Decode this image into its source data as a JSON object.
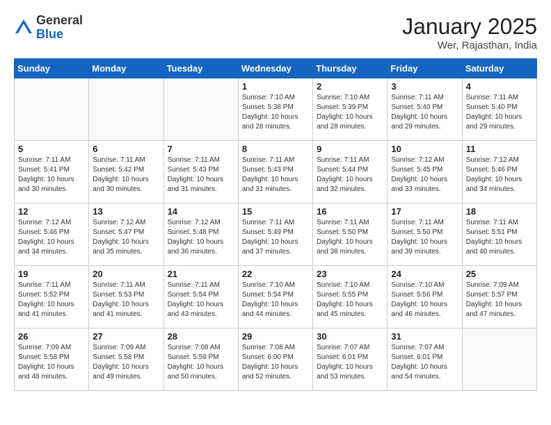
{
  "header": {
    "logo_general": "General",
    "logo_blue": "Blue",
    "title": "January 2025",
    "location": "Wer, Rajasthan, India"
  },
  "days_of_week": [
    "Sunday",
    "Monday",
    "Tuesday",
    "Wednesday",
    "Thursday",
    "Friday",
    "Saturday"
  ],
  "weeks": [
    [
      {
        "day": "",
        "info": ""
      },
      {
        "day": "",
        "info": ""
      },
      {
        "day": "",
        "info": ""
      },
      {
        "day": "1",
        "info": "Sunrise: 7:10 AM\nSunset: 5:38 PM\nDaylight: 10 hours\nand 28 minutes."
      },
      {
        "day": "2",
        "info": "Sunrise: 7:10 AM\nSunset: 5:39 PM\nDaylight: 10 hours\nand 28 minutes."
      },
      {
        "day": "3",
        "info": "Sunrise: 7:11 AM\nSunset: 5:40 PM\nDaylight: 10 hours\nand 29 minutes."
      },
      {
        "day": "4",
        "info": "Sunrise: 7:11 AM\nSunset: 5:40 PM\nDaylight: 10 hours\nand 29 minutes."
      }
    ],
    [
      {
        "day": "5",
        "info": "Sunrise: 7:11 AM\nSunset: 5:41 PM\nDaylight: 10 hours\nand 30 minutes."
      },
      {
        "day": "6",
        "info": "Sunrise: 7:11 AM\nSunset: 5:42 PM\nDaylight: 10 hours\nand 30 minutes."
      },
      {
        "day": "7",
        "info": "Sunrise: 7:11 AM\nSunset: 5:43 PM\nDaylight: 10 hours\nand 31 minutes."
      },
      {
        "day": "8",
        "info": "Sunrise: 7:11 AM\nSunset: 5:43 PM\nDaylight: 10 hours\nand 31 minutes."
      },
      {
        "day": "9",
        "info": "Sunrise: 7:11 AM\nSunset: 5:44 PM\nDaylight: 10 hours\nand 32 minutes."
      },
      {
        "day": "10",
        "info": "Sunrise: 7:12 AM\nSunset: 5:45 PM\nDaylight: 10 hours\nand 33 minutes."
      },
      {
        "day": "11",
        "info": "Sunrise: 7:12 AM\nSunset: 5:46 PM\nDaylight: 10 hours\nand 34 minutes."
      }
    ],
    [
      {
        "day": "12",
        "info": "Sunrise: 7:12 AM\nSunset: 5:46 PM\nDaylight: 10 hours\nand 34 minutes."
      },
      {
        "day": "13",
        "info": "Sunrise: 7:12 AM\nSunset: 5:47 PM\nDaylight: 10 hours\nand 35 minutes."
      },
      {
        "day": "14",
        "info": "Sunrise: 7:12 AM\nSunset: 5:48 PM\nDaylight: 10 hours\nand 36 minutes."
      },
      {
        "day": "15",
        "info": "Sunrise: 7:11 AM\nSunset: 5:49 PM\nDaylight: 10 hours\nand 37 minutes."
      },
      {
        "day": "16",
        "info": "Sunrise: 7:11 AM\nSunset: 5:50 PM\nDaylight: 10 hours\nand 38 minutes."
      },
      {
        "day": "17",
        "info": "Sunrise: 7:11 AM\nSunset: 5:50 PM\nDaylight: 10 hours\nand 39 minutes."
      },
      {
        "day": "18",
        "info": "Sunrise: 7:11 AM\nSunset: 5:51 PM\nDaylight: 10 hours\nand 40 minutes."
      }
    ],
    [
      {
        "day": "19",
        "info": "Sunrise: 7:11 AM\nSunset: 5:52 PM\nDaylight: 10 hours\nand 41 minutes."
      },
      {
        "day": "20",
        "info": "Sunrise: 7:11 AM\nSunset: 5:53 PM\nDaylight: 10 hours\nand 41 minutes."
      },
      {
        "day": "21",
        "info": "Sunrise: 7:11 AM\nSunset: 5:54 PM\nDaylight: 10 hours\nand 43 minutes."
      },
      {
        "day": "22",
        "info": "Sunrise: 7:10 AM\nSunset: 5:54 PM\nDaylight: 10 hours\nand 44 minutes."
      },
      {
        "day": "23",
        "info": "Sunrise: 7:10 AM\nSunset: 5:55 PM\nDaylight: 10 hours\nand 45 minutes."
      },
      {
        "day": "24",
        "info": "Sunrise: 7:10 AM\nSunset: 5:56 PM\nDaylight: 10 hours\nand 46 minutes."
      },
      {
        "day": "25",
        "info": "Sunrise: 7:09 AM\nSunset: 5:57 PM\nDaylight: 10 hours\nand 47 minutes."
      }
    ],
    [
      {
        "day": "26",
        "info": "Sunrise: 7:09 AM\nSunset: 5:58 PM\nDaylight: 10 hours\nand 48 minutes."
      },
      {
        "day": "27",
        "info": "Sunrise: 7:09 AM\nSunset: 5:58 PM\nDaylight: 10 hours\nand 49 minutes."
      },
      {
        "day": "28",
        "info": "Sunrise: 7:08 AM\nSunset: 5:59 PM\nDaylight: 10 hours\nand 50 minutes."
      },
      {
        "day": "29",
        "info": "Sunrise: 7:08 AM\nSunset: 6:00 PM\nDaylight: 10 hours\nand 52 minutes."
      },
      {
        "day": "30",
        "info": "Sunrise: 7:07 AM\nSunset: 6:01 PM\nDaylight: 10 hours\nand 53 minutes."
      },
      {
        "day": "31",
        "info": "Sunrise: 7:07 AM\nSunset: 6:01 PM\nDaylight: 10 hours\nand 54 minutes."
      },
      {
        "day": "",
        "info": ""
      }
    ]
  ]
}
